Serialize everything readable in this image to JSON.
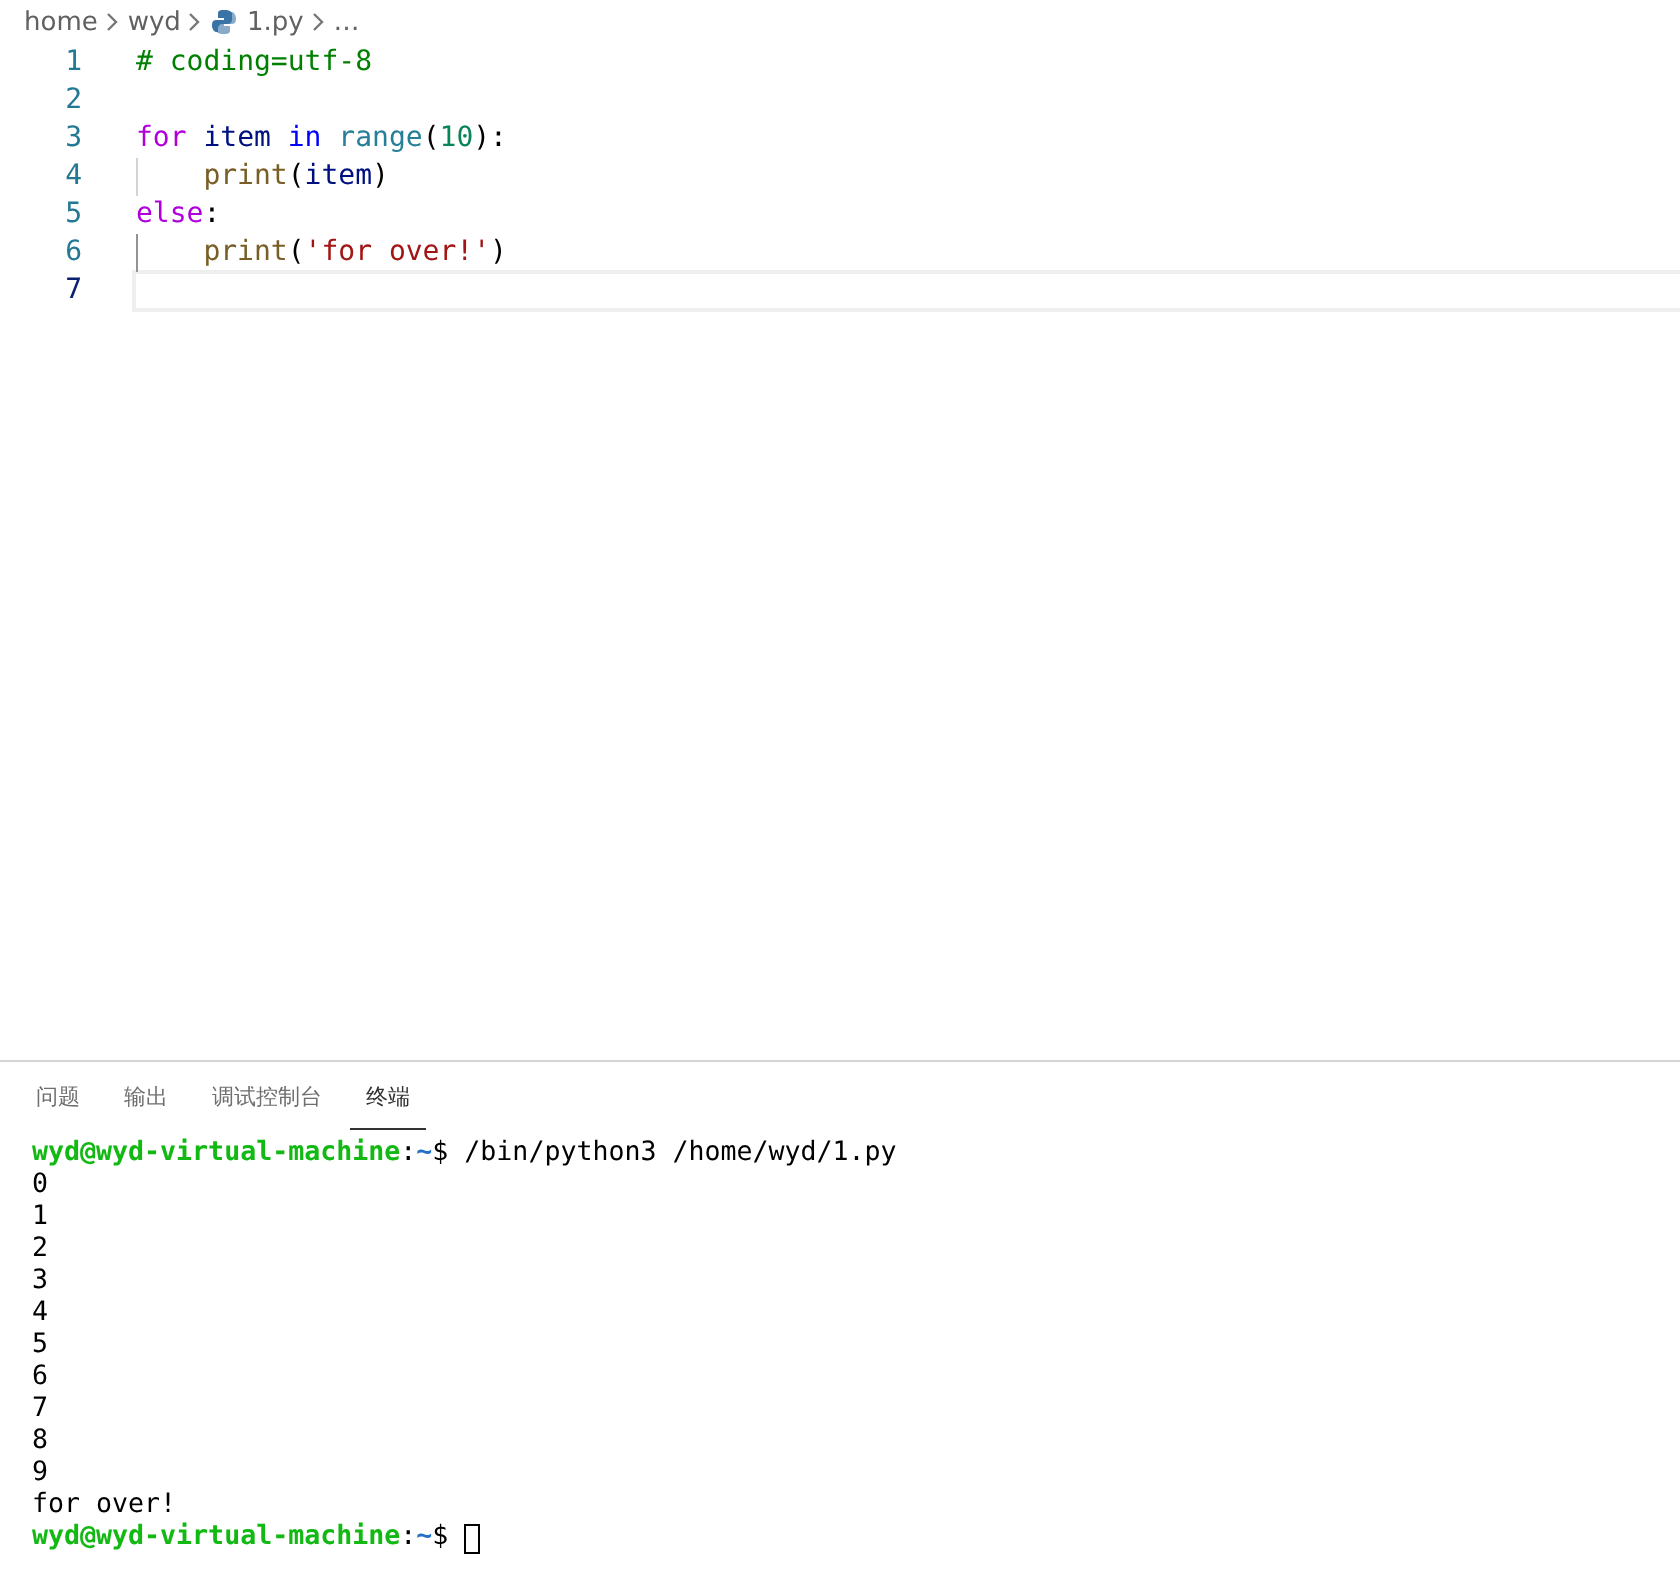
{
  "breadcrumb": [
    {
      "label": "home",
      "kind": "folder"
    },
    {
      "label": "wyd",
      "kind": "folder"
    },
    {
      "label": "1.py",
      "kind": "python-file"
    },
    {
      "label": "…",
      "kind": "more"
    }
  ],
  "editor": {
    "lines": [
      {
        "number": "1",
        "current": false,
        "tokens": [
          {
            "text": "# coding=utf-8",
            "kind": "comment"
          }
        ]
      },
      {
        "number": "2",
        "current": false
      },
      {
        "number": "3",
        "current": false,
        "tokens": [
          {
            "text": "for ",
            "kind": "keyword"
          },
          {
            "text": "item ",
            "kind": "variable"
          },
          {
            "text": "in ",
            "kind": "operator"
          },
          {
            "text": "range",
            "kind": "builtin"
          },
          {
            "text": "(",
            "kind": "plain"
          },
          {
            "text": "10",
            "kind": "number"
          },
          {
            "text": "):",
            "kind": "plain"
          }
        ]
      },
      {
        "number": "4",
        "current": false,
        "tokens": [
          {
            "kind": "indent"
          },
          {
            "text": "print",
            "kind": "function"
          },
          {
            "text": "(",
            "kind": "plain"
          },
          {
            "text": "item",
            "kind": "variable"
          },
          {
            "text": ")",
            "kind": "plain"
          }
        ]
      },
      {
        "number": "5",
        "current": false,
        "tokens": [
          {
            "text": "else",
            "kind": "keyword"
          },
          {
            "text": ":",
            "kind": "plain"
          }
        ]
      },
      {
        "number": "6",
        "current": false,
        "tokens": [
          {
            "kind": "indent-active"
          },
          {
            "text": "print",
            "kind": "function"
          },
          {
            "text": "(",
            "kind": "plain"
          },
          {
            "text": "'for over!'",
            "kind": "string"
          },
          {
            "text": ")",
            "kind": "plain"
          }
        ]
      },
      {
        "number": "7",
        "current": true
      }
    ]
  },
  "panel": {
    "tabs": [
      {
        "label": "问题",
        "selected": false
      },
      {
        "label": "输出",
        "selected": false
      },
      {
        "label": "调试控制台",
        "selected": false
      },
      {
        "label": "终端",
        "selected": true
      }
    ],
    "terminal": [
      [
        {
          "text": "wyd@wyd-virtual-machine",
          "kind": "user"
        },
        {
          "text": ":",
          "kind": "plain"
        },
        {
          "text": "~",
          "kind": "path"
        },
        {
          "text": "$ /bin/python3 /home/wyd/1.py",
          "kind": "plain"
        }
      ],
      [
        {
          "text": "0",
          "kind": "plain"
        }
      ],
      [
        {
          "text": "1",
          "kind": "plain"
        }
      ],
      [
        {
          "text": "2",
          "kind": "plain"
        }
      ],
      [
        {
          "text": "3",
          "kind": "plain"
        }
      ],
      [
        {
          "text": "4",
          "kind": "plain"
        }
      ],
      [
        {
          "text": "5",
          "kind": "plain"
        }
      ],
      [
        {
          "text": "6",
          "kind": "plain"
        }
      ],
      [
        {
          "text": "7",
          "kind": "plain"
        }
      ],
      [
        {
          "text": "8",
          "kind": "plain"
        }
      ],
      [
        {
          "text": "9",
          "kind": "plain"
        }
      ],
      [
        {
          "text": "for over!",
          "kind": "plain"
        }
      ],
      [
        {
          "text": "wyd@wyd-virtual-machine",
          "kind": "user"
        },
        {
          "text": ":",
          "kind": "plain"
        },
        {
          "text": "~",
          "kind": "path"
        },
        {
          "text": "$ ",
          "kind": "plain"
        },
        {
          "kind": "cursor"
        }
      ]
    ]
  }
}
